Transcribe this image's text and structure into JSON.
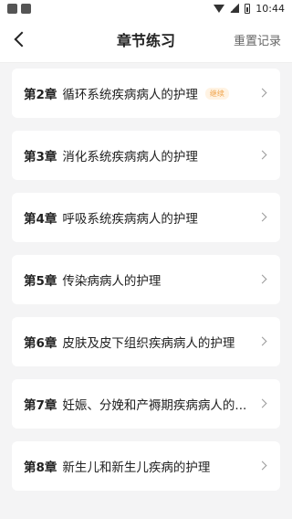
{
  "status_bar": {
    "time": "10:44"
  },
  "header": {
    "title": "章节练习",
    "reset_label": "重置记录"
  },
  "chapters": [
    {
      "chapter": "第2章",
      "title": "循环系统疾病病人的护理",
      "badge": "继续"
    },
    {
      "chapter": "第3章",
      "title": "消化系统疾病病人的护理"
    },
    {
      "chapter": "第4章",
      "title": "呼吸系统疾病病人的护理"
    },
    {
      "chapter": "第5章",
      "title": "传染病病人的护理"
    },
    {
      "chapter": "第6章",
      "title": "皮肤及皮下组织疾病病人的护理"
    },
    {
      "chapter": "第7章",
      "title": "妊娠、分娩和产褥期疾病病人的..."
    },
    {
      "chapter": "第8章",
      "title": "新生儿和新生儿疾病的护理"
    }
  ]
}
